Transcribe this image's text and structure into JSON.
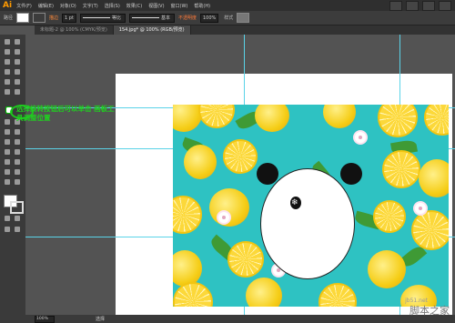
{
  "app": {
    "logo": "Ai"
  },
  "menubar": {
    "items": [
      "文件(F)",
      "编辑(E)",
      "对象(O)",
      "文字(T)",
      "选择(S)",
      "效果(C)",
      "视图(V)",
      "窗口(W)",
      "帮助(H)"
    ]
  },
  "control": {
    "path_label": "路径",
    "stroke_label": "描边",
    "stroke_weight": "1 pt",
    "uniform_label": "等比",
    "basic_label": "基本",
    "opacity_warn": "不透明度",
    "opacity_value": "100%",
    "style_label": "样式"
  },
  "tabs": [
    "未标题-2 @ 100% (CMYK/预览)",
    "154.jpg* @ 100% (RGB/预览)"
  ],
  "annotation": {
    "text": "选择旋转按钮后可以单击 画板工具调整位置",
    "color": "#1fd11f"
  },
  "status": {
    "zoom": "100%",
    "selection": "选择"
  },
  "watermark": {
    "site": "脚本之家",
    "url": "jb51.net"
  },
  "colors": {
    "guide": "#5ad3e8",
    "pattern_bg": "#2ec2c2",
    "app_bg": "#535353"
  },
  "icons": [
    "selection-tool-icon",
    "direct-selection-icon",
    "magic-wand-icon",
    "lasso-icon",
    "pen-icon",
    "type-icon",
    "line-icon",
    "rectangle-icon",
    "paintbrush-icon",
    "pencil-icon",
    "eraser-icon",
    "rotate-icon",
    "scale-icon",
    "width-icon",
    "free-transform-icon",
    "shape-builder-icon",
    "perspective-icon",
    "mesh-icon",
    "gradient-icon",
    "eyedropper-icon",
    "blend-icon",
    "symbol-sprayer-icon",
    "graph-icon",
    "artboard-icon",
    "slice-icon",
    "hand-icon",
    "zoom-icon"
  ]
}
